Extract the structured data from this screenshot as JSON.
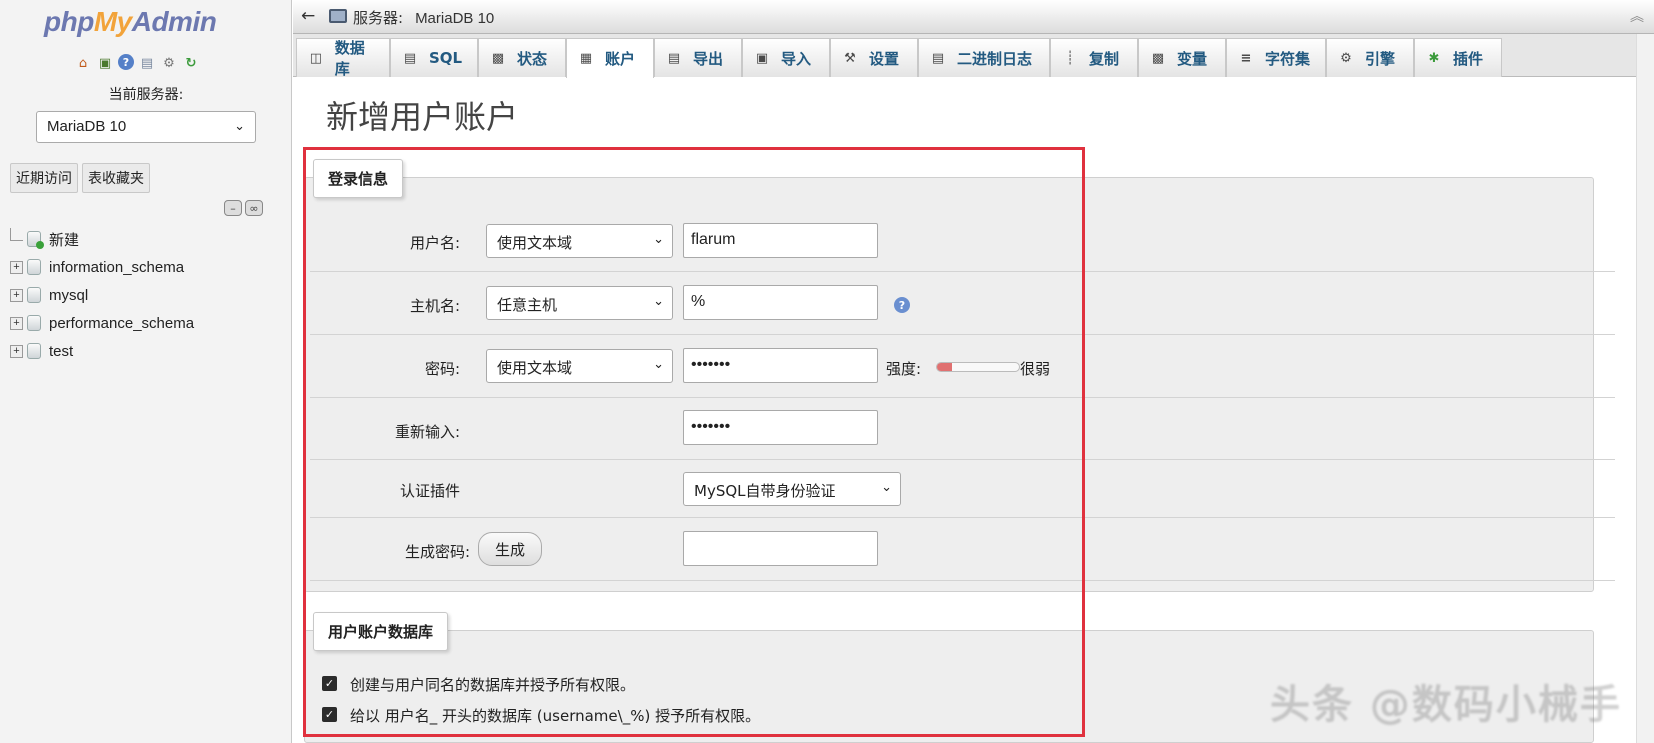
{
  "nav": {
    "logo": {
      "php": "php",
      "my": "My",
      "admin": "Admin"
    },
    "icons": [
      "home-icon",
      "exit-icon",
      "help-icon",
      "docs-icon",
      "settings-icon",
      "reload-icon"
    ],
    "server_label": "当前服务器:",
    "server_select": "MariaDB 10",
    "tabs": [
      "近期访问",
      "表收藏夹"
    ],
    "tree": [
      "新建",
      "information_schema",
      "mysql",
      "performance_schema",
      "test"
    ]
  },
  "topbar": {
    "back": "←",
    "server_prefix": "服务器:",
    "server_name": "MariaDB 10",
    "collapse": "︽"
  },
  "tabs": [
    {
      "label": "数据库",
      "icon": "database-icon"
    },
    {
      "label": "SQL",
      "icon": "sql-icon"
    },
    {
      "label": "状态",
      "icon": "status-icon"
    },
    {
      "label": "账户",
      "icon": "accounts-icon",
      "active": true
    },
    {
      "label": "导出",
      "icon": "export-icon"
    },
    {
      "label": "导入",
      "icon": "import-icon"
    },
    {
      "label": "设置",
      "icon": "wrench-icon"
    },
    {
      "label": "二进制日志",
      "icon": "binlog-icon"
    },
    {
      "label": "复制",
      "icon": "replication-icon"
    },
    {
      "label": "变量",
      "icon": "variables-icon"
    },
    {
      "label": "字符集",
      "icon": "charset-icon"
    },
    {
      "label": "引擎",
      "icon": "engine-icon"
    },
    {
      "label": "插件",
      "icon": "plugin-icon"
    }
  ],
  "page_title": "新增用户账户",
  "login": {
    "legend": "登录信息",
    "username_label": "用户名:",
    "username_mode": "使用文本域",
    "username_value": "flarum",
    "host_label": "主机名:",
    "host_mode": "任意主机",
    "host_value": "%",
    "password_label": "密码:",
    "password_mode": "使用文本域",
    "password_value": "•••••••",
    "strength_label": "强度:",
    "strength_level": 0.18,
    "strength_text": "很弱",
    "retype_label": "重新输入:",
    "retype_value": "•••••••",
    "auth_label": "认证插件",
    "auth_value": "MySQL自带身份验证",
    "generate_label": "生成密码:",
    "generate_button": "生成",
    "generated_value": ""
  },
  "userdb": {
    "legend": "用户账户数据库",
    "option1": "创建与用户同名的数据库并授予所有权限。",
    "option2": "给以 用户名_ 开头的数据库 (username\\_%) 授予所有权限。"
  },
  "colors": {
    "accent": "#235a81",
    "highlight_box": "#e0313e"
  },
  "watermark": "头条 @数码小械手"
}
